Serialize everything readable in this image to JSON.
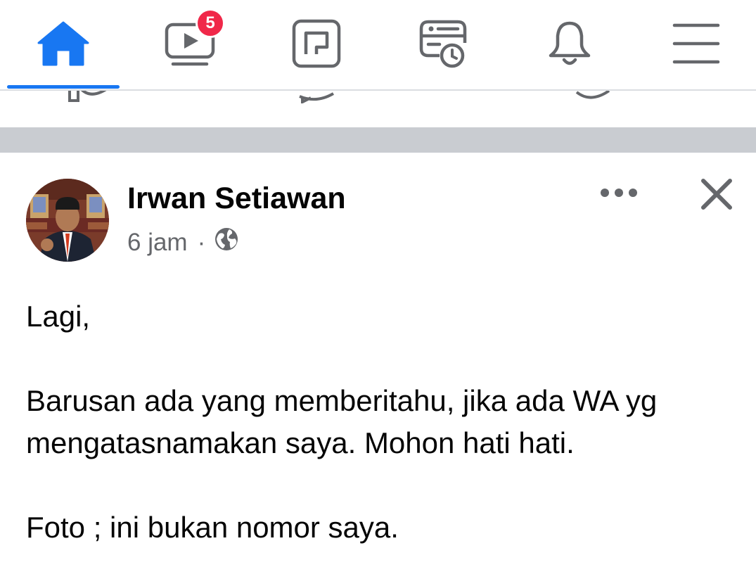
{
  "nav": {
    "tabs": [
      {
        "name": "home",
        "icon": "home-icon",
        "active": true
      },
      {
        "name": "watch",
        "icon": "watch-video-icon",
        "badge": "5"
      },
      {
        "name": "gaming",
        "icon": "gaming-icon"
      },
      {
        "name": "memories",
        "icon": "memories-icon"
      },
      {
        "name": "notifications",
        "icon": "bell-icon"
      },
      {
        "name": "menu",
        "icon": "hamburger-menu-icon"
      }
    ],
    "accent_color": "#1877f2",
    "badge_color": "#f02849"
  },
  "peek_actions": [
    {
      "icon": "like-icon"
    },
    {
      "icon": "comment-icon"
    },
    {
      "icon": "share-icon"
    }
  ],
  "post": {
    "author": "Irwan Setiawan",
    "time": "6 jam",
    "separator": "·",
    "privacy_icon": "globe-icon",
    "paragraphs": [
      "Lagi,",
      "Barusan ada yang memberitahu, jika ada WA yg mengatasnamakan saya. Mohon hati hati.",
      "Foto ; ini bukan nomor saya."
    ]
  }
}
